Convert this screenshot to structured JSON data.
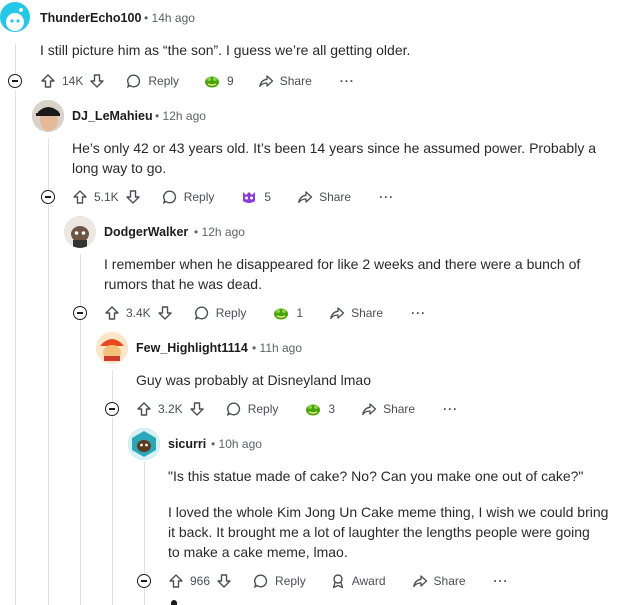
{
  "comments": [
    {
      "author": "ThunderEcho100",
      "time": "14h ago",
      "body": [
        "I still picture him as “the son”. I guess we’re all getting older."
      ],
      "score": "14K",
      "reply_label": "Reply",
      "award_count": "9",
      "share_label": "Share"
    },
    {
      "author": "DJ_LeMahieu",
      "time": "12h ago",
      "body": [
        "He’s only 42 or 43 years old. It’s been 14 years since he assumed power. Probably a",
        "long way to go."
      ],
      "score": "5.1K",
      "reply_label": "Reply",
      "award_count": "5",
      "share_label": "Share"
    },
    {
      "author": "DodgerWalker",
      "time": "12h ago",
      "body": [
        "I remember when he disappeared for like 2 weeks and there were a bunch of",
        "rumors that he was dead."
      ],
      "score": "3.4K",
      "reply_label": "Reply",
      "award_count": "1",
      "share_label": "Share"
    },
    {
      "author": "Few_Highlight1114",
      "time": "11h ago",
      "body": [
        "Guy was probably at Disneyland lmao"
      ],
      "score": "3.2K",
      "reply_label": "Reply",
      "award_count": "3",
      "share_label": "Share"
    },
    {
      "author": "sicurri",
      "time": "10h ago",
      "body": [
        "\"Is this statue made of cake? No? Can you make one out of cake?\"",
        "I loved the whole Kim Jong Un Cake meme thing, I wish we could bring",
        "it back. It brought me a lot of laughter the lengths people were going",
        "to make a cake meme, lmao."
      ],
      "score": "966",
      "reply_label": "Reply",
      "award_label": "Award",
      "share_label": "Share"
    }
  ],
  "more_icon": "ellipsis-icon",
  "colors": {
    "thread_line": "#dde1e5",
    "text": "#2a2a2a",
    "meta": "#5f6368"
  }
}
